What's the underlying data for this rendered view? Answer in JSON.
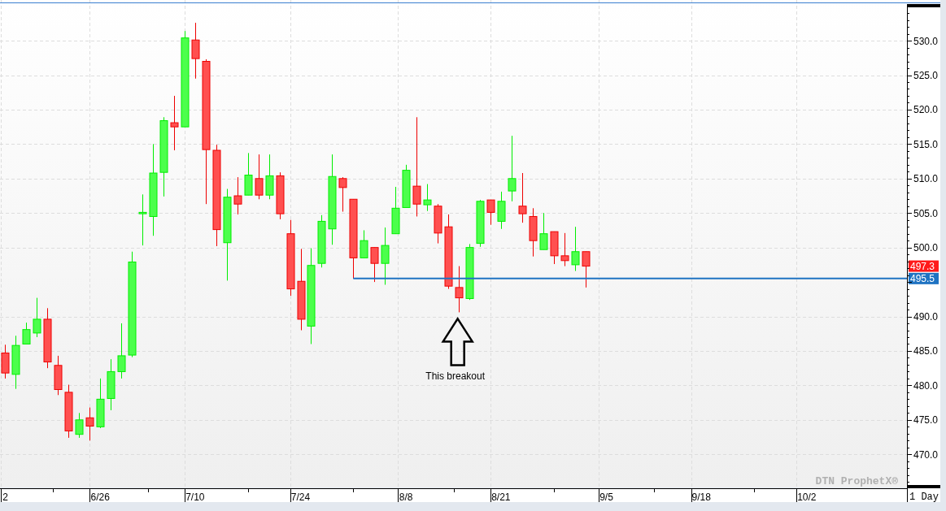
{
  "chart": {
    "chart_data": {
      "type": "candlestick",
      "grid": true,
      "ylim": [
        465.2,
        535.9
      ],
      "categories": [
        "2",
        null,
        null,
        null,
        null,
        null,
        null,
        null,
        null,
        "6/26",
        null,
        null,
        null,
        null,
        null,
        null,
        null,
        null,
        "7/10",
        null,
        null,
        null,
        null,
        null,
        null,
        null,
        null,
        null,
        "7/24",
        null,
        null,
        null,
        null,
        null,
        null,
        null,
        null,
        null,
        "8/8",
        null,
        null,
        null,
        null,
        null,
        null,
        null,
        null,
        "8/21",
        null,
        null,
        null,
        null,
        null,
        null,
        null,
        null,
        null,
        "9/5",
        null,
        null,
        null,
        null,
        null,
        null,
        null,
        null,
        "9/18",
        null,
        null,
        null,
        null,
        null,
        null,
        null,
        null,
        null,
        "10/2",
        null,
        null,
        null,
        null,
        null,
        null,
        null,
        null,
        null
      ],
      "yticks": [
        {
          "value": 530,
          "label": "530.0"
        },
        {
          "value": 525,
          "label": "525.0"
        },
        {
          "value": 520,
          "label": "520.0"
        },
        {
          "value": 515,
          "label": "515.0"
        },
        {
          "value": 510,
          "label": "510.0"
        },
        {
          "value": 505,
          "label": "505.0"
        },
        {
          "value": 500,
          "label": "500.0"
        },
        {
          "value": 490,
          "label": "490.0"
        },
        {
          "value": 485,
          "label": "485.0"
        },
        {
          "value": 480,
          "label": "480.0"
        },
        {
          "value": 475,
          "label": "475.0"
        },
        {
          "value": 470,
          "label": "470.0"
        }
      ],
      "ohlc": [
        [
          484.7,
          485.9,
          481.0,
          481.8
        ],
        [
          481.6,
          487.2,
          479.5,
          485.8
        ],
        [
          486.0,
          489.1,
          486.0,
          488.1
        ],
        [
          487.6,
          492.7,
          487.0,
          489.6
        ],
        [
          489.6,
          491.2,
          482.5,
          483.4
        ],
        [
          482.9,
          484.3,
          478.6,
          479.4
        ],
        [
          479.0,
          480.1,
          472.4,
          473.4
        ],
        [
          472.9,
          476.0,
          472.4,
          475.0
        ],
        [
          475.3,
          476.8,
          472.0,
          474.1
        ],
        [
          474.0,
          481.0,
          473.8,
          478.0
        ],
        [
          478.1,
          483.8,
          476.4,
          482.0
        ],
        [
          482.0,
          489.0,
          481.0,
          484.3
        ],
        [
          484.4,
          499.4,
          484.1,
          497.9
        ],
        [
          504.9,
          507.7,
          500.3,
          505.1
        ],
        [
          504.5,
          515.0,
          501.7,
          510.8
        ],
        [
          510.9,
          518.9,
          507.4,
          518.4
        ],
        [
          518.1,
          522.0,
          514.1,
          517.5
        ],
        [
          517.5,
          531.4,
          517.5,
          530.4
        ],
        [
          530.1,
          532.6,
          524.5,
          527.4
        ],
        [
          527.0,
          527.3,
          506.3,
          514.2
        ],
        [
          514.1,
          514.9,
          500.2,
          502.6
        ],
        [
          500.7,
          508.5,
          495.2,
          507.3
        ],
        [
          507.5,
          510.2,
          504.8,
          506.3
        ],
        [
          507.6,
          513.7,
          507.6,
          510.5
        ],
        [
          510.0,
          513.5,
          507.0,
          507.6
        ],
        [
          507.6,
          513.5,
          507.0,
          510.4
        ],
        [
          510.4,
          510.9,
          504.1,
          504.9
        ],
        [
          502.0,
          504.0,
          493.0,
          494.0
        ],
        [
          495.1,
          499.8,
          488.0,
          489.6
        ],
        [
          488.6,
          499.9,
          486.0,
          497.4
        ],
        [
          497.7,
          504.7,
          497.1,
          503.8
        ],
        [
          502.7,
          513.5,
          500.4,
          510.3
        ],
        [
          510.0,
          510.2,
          505.2,
          508.7
        ],
        [
          507.0,
          507.0,
          495.5,
          498.5
        ],
        [
          498.5,
          502.5,
          498.5,
          501.0
        ],
        [
          500.0,
          500.0,
          495.0,
          497.7
        ],
        [
          497.7,
          502.9,
          494.6,
          500.3
        ],
        [
          502.0,
          508.8,
          502.0,
          505.7
        ],
        [
          505.8,
          512.0,
          505.8,
          511.2
        ],
        [
          508.9,
          518.9,
          504.5,
          506.3
        ],
        [
          506.2,
          509.2,
          505.3,
          506.9
        ],
        [
          506.0,
          506.3,
          500.6,
          502.1
        ],
        [
          503.0,
          504.8,
          494.0,
          494.4
        ],
        [
          494.2,
          497.3,
          490.6,
          492.7
        ],
        [
          492.6,
          500.5,
          492.4,
          500.0
        ],
        [
          500.6,
          506.9,
          500.1,
          506.7
        ],
        [
          506.9,
          506.9,
          503.3,
          505.1
        ],
        [
          503.8,
          508.1,
          502.7,
          506.7
        ],
        [
          508.2,
          516.2,
          506.7,
          510.0
        ],
        [
          506.0,
          510.8,
          503.6,
          504.9
        ],
        [
          504.5,
          505.7,
          498.7,
          501.0
        ],
        [
          499.7,
          505.0,
          499.7,
          502.0
        ],
        [
          502.3,
          502.3,
          497.6,
          498.8
        ],
        [
          498.8,
          502.1,
          497.3,
          498.1
        ],
        [
          497.5,
          503.0,
          496.6,
          499.4
        ],
        [
          499.4,
          499.4,
          494.2,
          497.3
        ],
        null,
        null,
        null,
        null,
        null,
        null,
        null,
        null,
        null,
        null,
        null,
        null,
        null,
        null,
        null,
        null,
        null,
        null,
        null,
        null,
        null,
        null,
        null,
        null,
        null,
        null,
        null,
        null,
        null,
        null
      ],
      "ref_lines": [
        {
          "value": 495.5,
          "axis": "y",
          "label": "495.5"
        }
      ],
      "annotations": [
        "This breakout"
      ]
    },
    "last_price": "497.3",
    "brand": "DTN ProphetX®",
    "interval": "1 Day"
  }
}
